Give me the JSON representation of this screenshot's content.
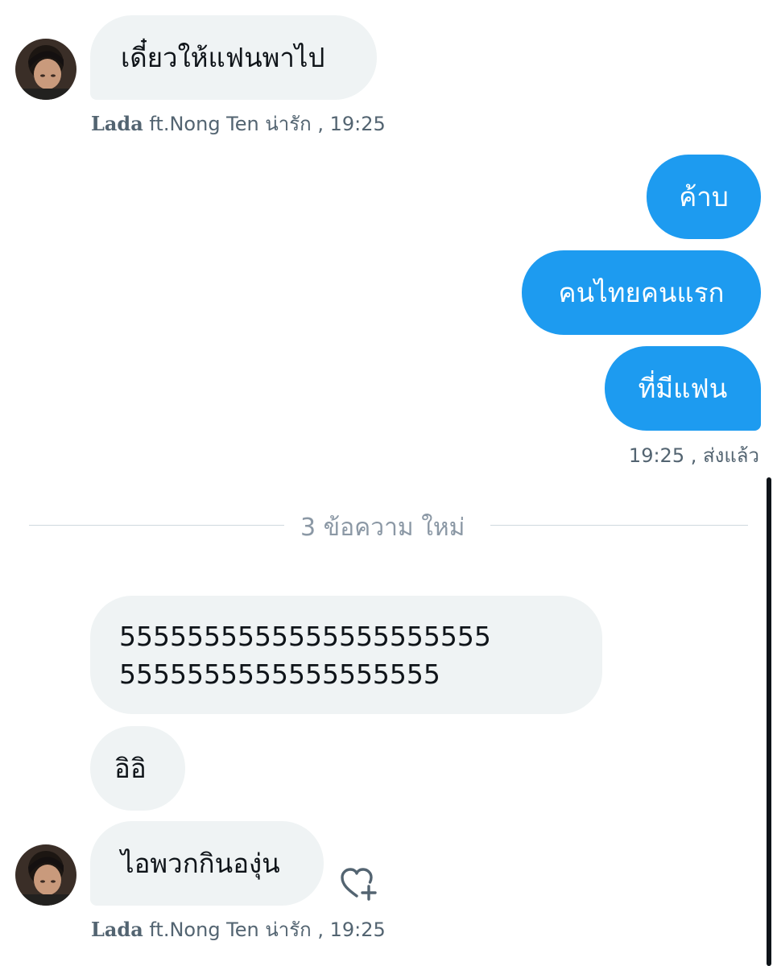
{
  "messages_top": {
    "in_1": {
      "text": "เดี๋ยวให้แฟนพาไป",
      "sender_name": "Lada",
      "sender_suffix": "ft.Nong Ten น่ารัก",
      "time": ", 19:25"
    },
    "out": [
      {
        "text": "ค้าบ"
      },
      {
        "text": "คนไทยคนแรก"
      },
      {
        "text": "ที่มีแฟน"
      }
    ],
    "out_status": "19:25 , ส่งแล้ว"
  },
  "divider": {
    "label": "3 ข้อความ ใหม่"
  },
  "messages_new": {
    "long_line_1": "5555555555555555555555",
    "long_line_2": "5555555555555555555",
    "short": "อิอิ",
    "last": {
      "text": "ไอพวกกินองุ่น",
      "sender_name": "Lada",
      "sender_suffix": "ft.Nong Ten น่ารัก",
      "time": ", 19:25"
    }
  },
  "icons": {
    "avatar": "avatar-photo",
    "react": "heart-plus-icon"
  },
  "colors": {
    "outgoing_bubble": "#1d9bf0",
    "incoming_bubble": "#eff3f4",
    "meta_text": "#536471",
    "divider_text": "#8b98a5"
  }
}
